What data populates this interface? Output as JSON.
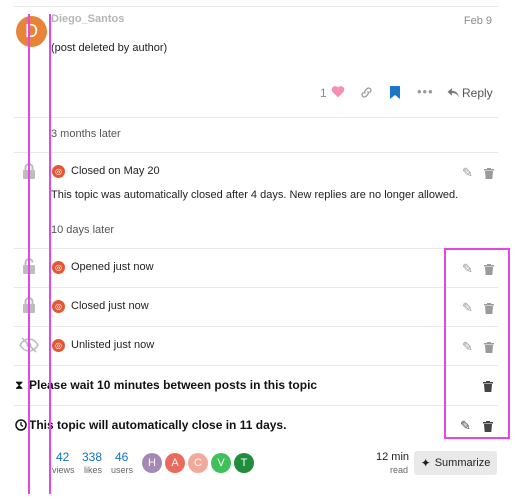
{
  "post": {
    "avatar_letter": "D",
    "username": "Diego_Santos",
    "date": "Feb 9",
    "body": "(post deleted by author)",
    "like_count": "1",
    "reply_label": "Reply"
  },
  "gaps": {
    "first": "3 months later",
    "second": "10 days later"
  },
  "events": [
    {
      "icon": "lock-icon",
      "label": "Closed on May 20"
    },
    {
      "icon": "unlock-icon",
      "label": "Opened just now"
    },
    {
      "icon": "lock-icon",
      "label": "Closed just now"
    },
    {
      "icon": "eye-slash-icon",
      "label": "Unlisted just now"
    }
  ],
  "closed_notice": "This topic was automatically closed after 4 days. New replies are no longer allowed.",
  "timers": {
    "slow_mode": "Please wait 10 minutes between posts in this topic",
    "auto_close": "This topic will automatically close in 11 days."
  },
  "stats": {
    "views_count": "42",
    "views_label": "views",
    "likes_count": "338",
    "likes_label": "likes",
    "users_count": "46",
    "users_label": "users",
    "read_time": "12 min",
    "read_label": "read"
  },
  "participants": [
    {
      "letter": "H",
      "color": "#a48ab3"
    },
    {
      "letter": "A",
      "color": "#ea6b5d"
    },
    {
      "letter": "C",
      "color": "#f0a99a"
    },
    {
      "letter": "V",
      "color": "#3fc05a"
    },
    {
      "letter": "T",
      "color": "#1f8d3c"
    }
  ],
  "summarize_label": "Summarize",
  "colors": {
    "accent": "#e45735",
    "link": "#0f72c6",
    "guide": "#e448e4",
    "bookmark": "#1877c9",
    "heart": "#f48fb1"
  }
}
